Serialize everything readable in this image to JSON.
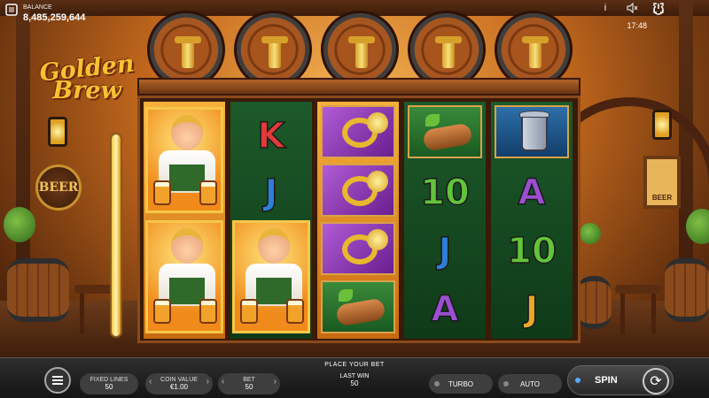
{
  "header": {
    "balance_label": "BALANCE",
    "balance_value": "8,485,259,644",
    "time": "17:48",
    "icons": [
      "menu-icon",
      "info-icon",
      "sound-off-icon",
      "fullscreen-icon",
      "power-icon"
    ]
  },
  "logo": {
    "line1": "Golden",
    "line2": "Brew"
  },
  "decor": {
    "beer_sign": "BEER",
    "frame_sign": "BEER"
  },
  "reels": {
    "reel2": [
      "K",
      "J"
    ],
    "reel4": [
      "10",
      "J",
      "A"
    ],
    "reel5": [
      "A",
      "10",
      "J"
    ],
    "symbols": {
      "reel1": [
        "maid",
        "maid"
      ],
      "reel2": [
        "K",
        "J",
        "maid"
      ],
      "reel3": [
        "horn",
        "horn",
        "horn",
        "sausage"
      ],
      "reel4": [
        "sausage",
        "10",
        "J",
        "A"
      ],
      "reel5": [
        "stein",
        "A",
        "10",
        "J"
      ]
    }
  },
  "colors": {
    "K": "#e23a3a",
    "J_blue": "#2f7fd8",
    "ten_green": "#63c43a",
    "A_purple": "#9a4fd0",
    "J_green": "#63c43a",
    "ten_green_r5": "#63c43a",
    "J_gold": "#e8a82a"
  },
  "bottom_bar": {
    "status": "PLACE YOUR BET",
    "fixed_lines_label": "FIXED LINES",
    "fixed_lines_value": "50",
    "coin_value_label": "COIN VALUE",
    "coin_value_value": "€1.00",
    "bet_label": "BET",
    "bet_value": "50",
    "last_win_label": "LAST WIN",
    "last_win_value": "50",
    "turbo_label": "TURBO",
    "auto_label": "AUTO",
    "spin_label": "SPIN"
  }
}
